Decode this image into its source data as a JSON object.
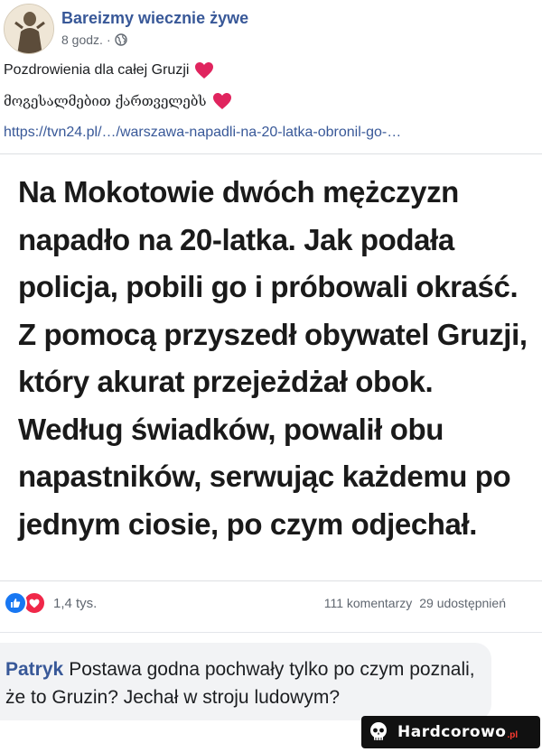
{
  "post": {
    "page_name": "Bareizmy wiecznie żywe",
    "time": "8 godz.",
    "separator": "·",
    "audience_icon": "globe-icon",
    "line1": "Pozdrowienia dla całej Gruzji",
    "line2": "მოგესალმებით ქართველებს",
    "heart_icon": "red-heart-icon",
    "link": "https://tvn24.pl/…/warszawa-napadli-na-20-latka-obronil-go-…"
  },
  "article": {
    "text": "Na Mokotowie dwóch mężczyzn napadło na 20-latka. Jak podała policja, pobili go i próbowali okraść. Z pomocą przyszedł obywatel Gruzji, który akurat przejeżdżał obok. Według świadków, powalił obu napastników, serwując każdemu po jednym ciosie, po czym odjechał."
  },
  "stats": {
    "reaction_icons": [
      "like-icon",
      "love-icon"
    ],
    "reactions_count": "1,4 tys.",
    "comments": "111 komentarzy",
    "shares": "29 udostępnień"
  },
  "comment": {
    "author": "Patryk",
    "text": "Postawa godna pochwały tylko po czym poznali, że to Gruzin? Jechał w stroju ludowym?"
  },
  "watermark": {
    "text": "Hardcorowo",
    "suffix": ".pl"
  },
  "colors": {
    "link_blue": "#385898",
    "like_blue": "#1877f2",
    "love_red": "#f02849",
    "heart_red": "#e0245e",
    "meta_gray": "#606770"
  }
}
